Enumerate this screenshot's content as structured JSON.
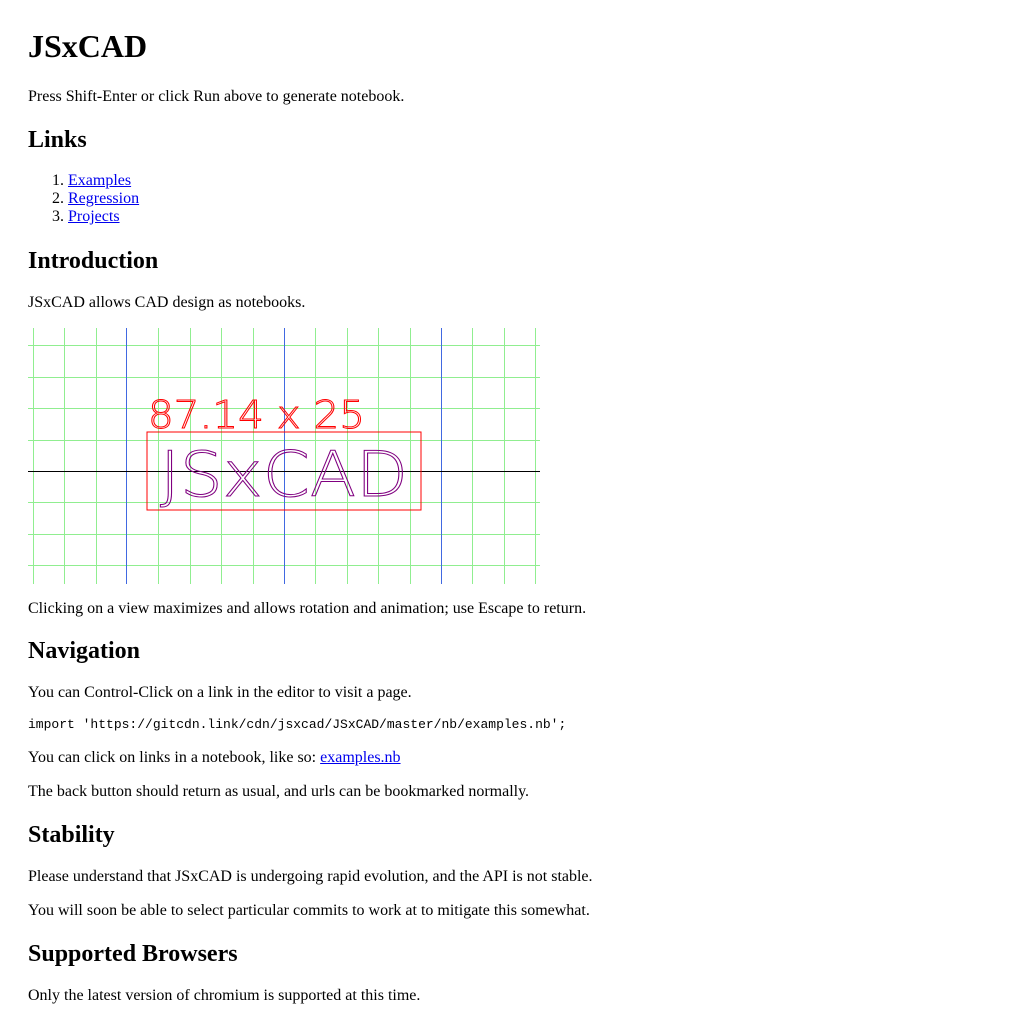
{
  "title": "JSxCAD",
  "intro_run_text": "Press Shift-Enter or click Run above to generate notebook.",
  "links": {
    "heading": "Links",
    "items": [
      "Examples",
      "Regression",
      "Projects"
    ]
  },
  "introduction": {
    "heading": "Introduction",
    "text": "JSxCAD allows CAD design as notebooks.",
    "view": {
      "dimension_label": "87.14 x 25",
      "model_text": "JSxCAD",
      "colors": {
        "grid": "#90ee90",
        "axis_major": "#4169e1",
        "axis_horizontal": "#000000",
        "bounding_box": "#ff0000",
        "model": "#800080"
      }
    },
    "after_view_text": "Clicking on a view maximizes and allows rotation and animation; use Escape to return."
  },
  "navigation": {
    "heading": "Navigation",
    "text1": "You can Control-Click on a link in the editor to visit a page.",
    "code": "import 'https://gitcdn.link/cdn/jsxcad/JSxCAD/master/nb/examples.nb';",
    "text2_prefix": "You can click on links in a notebook, like so: ",
    "text2_link": "examples.nb",
    "text3": "The back button should return as usual, and urls can be bookmarked normally."
  },
  "stability": {
    "heading": "Stability",
    "text1": "Please understand that JSxCAD is undergoing rapid evolution, and the API is not stable.",
    "text2": "You will soon be able to select particular commits to work at to mitigate this somewhat."
  },
  "browsers": {
    "heading": "Supported Browsers",
    "text1": "Only the latest version of chromium is supported at this time."
  }
}
